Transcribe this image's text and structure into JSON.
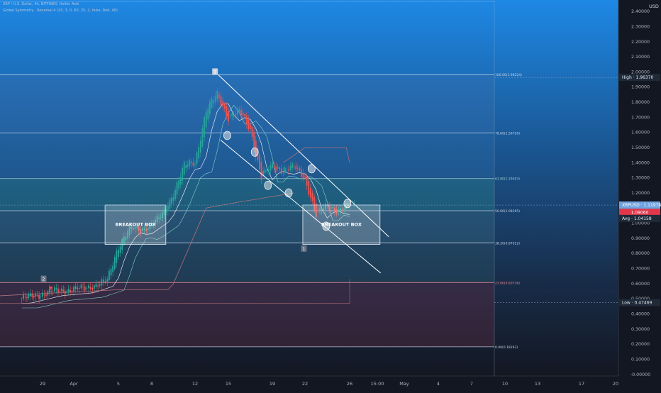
{
  "header": {
    "symbol_line": "XRP / U.S. Dollar, 4h, BITFINEX, Heikin Ashi",
    "indicator_line": "Global Symmetry · Reversal 4 (20, 3, 0, 60, 25, 2, false, Red, 40)"
  },
  "price_axis": {
    "currency": "USD",
    "min": -0.0,
    "max": 2.4,
    "ticks": [
      "2.40000",
      "2.30000",
      "2.20000",
      "2.10000",
      "2.00000",
      "1.90000",
      "1.80000",
      "1.70000",
      "1.60000",
      "1.50000",
      "1.40000",
      "1.30000",
      "1.20000",
      "1.10000",
      "1.00000",
      "0.90000",
      "0.80000",
      "0.70000",
      "0.60000",
      "0.50000",
      "0.40000",
      "0.30000",
      "0.20000",
      "0.10000",
      "-0.00000"
    ],
    "tick_values": [
      2.4,
      2.3,
      2.2,
      2.1,
      2.0,
      1.9,
      1.8,
      1.7,
      1.6,
      1.5,
      1.4,
      1.3,
      1.2,
      1.1,
      1.0,
      0.9,
      0.8,
      0.7,
      0.6,
      0.5,
      0.4,
      0.3,
      0.2,
      0.1,
      0.0
    ]
  },
  "labels": {
    "high": {
      "text": "High",
      "value": "1.96370",
      "price": 1.9637
    },
    "symbol": {
      "text": "XRPUSD",
      "value": "1.11978",
      "price": 1.11978,
      "countdown": "06:52"
    },
    "red": {
      "value": "1.09060",
      "price": 1.0906
    },
    "avg": {
      "text": "Avg",
      "value": "1.04158",
      "price": 1.04158
    },
    "low": {
      "text": "Low",
      "value": "0.47469",
      "price": 0.47469
    }
  },
  "time_axis": {
    "ticks": [
      "29",
      "Apr",
      "5",
      "8",
      "12",
      "15",
      "19",
      "22",
      "26",
      "15:00",
      "May",
      "4",
      "7",
      "10",
      "13",
      "17",
      "20"
    ]
  },
  "fib_levels": [
    {
      "label": "100.00(1.98224)",
      "price": 1.98224,
      "color": "#c8d4e8"
    },
    {
      "label": "78.60(1.59720)",
      "price": 1.5972,
      "color": "#c8d4e8"
    },
    {
      "label": "61.80(1.29493)",
      "price": 1.29493,
      "color": "#9fd6d0"
    },
    {
      "label": "50.00(1.08265)",
      "price": 1.08265,
      "color": "#c8d4e8"
    },
    {
      "label": "38.20(0.87012)",
      "price": 0.87012,
      "color": "#c8d4e8"
    },
    {
      "label": "23.60(0.60736)",
      "price": 0.60736,
      "color": "#e88a96"
    },
    {
      "label": "0.00(0.18263)",
      "price": 0.18263,
      "color": "#c8d4e8"
    }
  ],
  "boxes": [
    {
      "text": "BREAKOUT BOX"
    },
    {
      "text": "BREAKOUT BOX"
    }
  ],
  "markers": [
    "2",
    "1",
    "1"
  ],
  "colors": {
    "up_candle": "#26a69a",
    "down_candle": "#ef5350",
    "fib_line": "#c8d4e8",
    "trend_line": "#ffffff",
    "band_line": "#b0707a",
    "background_top": "#1e88e5",
    "background_bottom": "#131722"
  },
  "chart_data": {
    "type": "candlestick",
    "title": "XRP / U.S. Dollar, 4h, BITFINEX, Heikin Ashi",
    "ylabel": "USD",
    "ylim": [
      0.0,
      2.4
    ],
    "grid": false,
    "approx_close_path": [
      {
        "x": "Mar 27",
        "y": 0.5
      },
      {
        "x": "Mar 30",
        "y": 0.55
      },
      {
        "x": "Apr 2",
        "y": 0.57
      },
      {
        "x": "Apr 4",
        "y": 0.62
      },
      {
        "x": "Apr 5",
        "y": 0.85
      },
      {
        "x": "Apr 6",
        "y": 0.97
      },
      {
        "x": "Apr 7",
        "y": 0.95
      },
      {
        "x": "Apr 9",
        "y": 1.05
      },
      {
        "x": "Apr 10",
        "y": 1.2
      },
      {
        "x": "Apr 11",
        "y": 1.38
      },
      {
        "x": "Apr 12",
        "y": 1.4
      },
      {
        "x": "Apr 13",
        "y": 1.75
      },
      {
        "x": "Apr 14",
        "y": 1.85
      },
      {
        "x": "Apr 15",
        "y": 1.7
      },
      {
        "x": "Apr 16",
        "y": 1.74
      },
      {
        "x": "Apr 17",
        "y": 1.62
      },
      {
        "x": "Apr 18",
        "y": 1.3
      },
      {
        "x": "Apr 19",
        "y": 1.38
      },
      {
        "x": "Apr 20",
        "y": 1.35
      },
      {
        "x": "Apr 21",
        "y": 1.37
      },
      {
        "x": "Apr 22",
        "y": 1.3
      },
      {
        "x": "Apr 23",
        "y": 1.05
      },
      {
        "x": "Apr 24",
        "y": 1.12
      },
      {
        "x": "Apr 25",
        "y": 1.08
      },
      {
        "x": "Apr 26",
        "y": 1.12
      }
    ]
  }
}
